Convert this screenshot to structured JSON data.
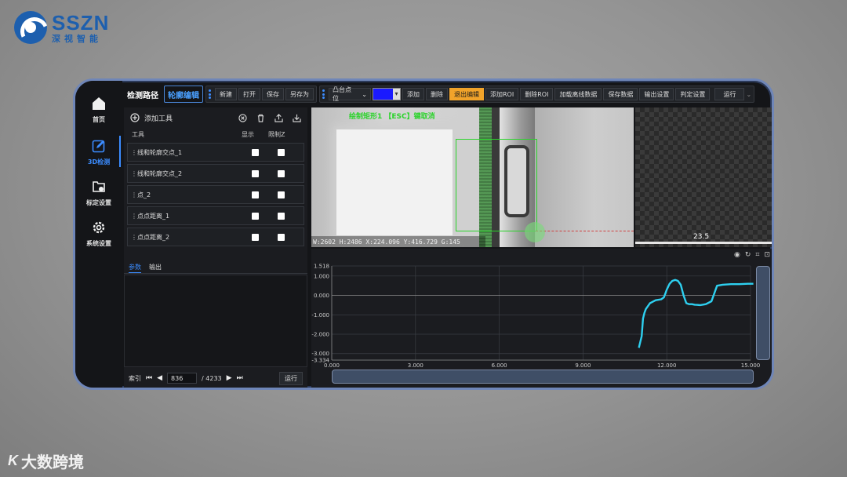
{
  "brand": {
    "name": "SSZN",
    "cn": "深视智能"
  },
  "watermark": {
    "mark": "K",
    "text": "大数跨境"
  },
  "sidebar": {
    "items": [
      {
        "label": "首页",
        "icon": "home-icon"
      },
      {
        "label": "3D检测",
        "icon": "edit-icon",
        "active": true
      },
      {
        "label": "标定设置",
        "icon": "calibration-icon"
      },
      {
        "label": "系统设置",
        "icon": "gear-icon"
      }
    ]
  },
  "toolbar": {
    "path_label": "检测路径",
    "contour_edit": "轮廓编辑",
    "file_buttons": [
      "新建",
      "打开",
      "保存",
      "另存为"
    ],
    "shape_select": "凸台点位",
    "add": "添加",
    "delete": "删除",
    "exit_edit": "退出编辑",
    "add_roi": "添加ROI",
    "delete_roi": "删除ROI",
    "load_offline": "加载离线数据",
    "save_data": "保存数据",
    "output_settings": "输出设置",
    "judge_settings": "判定设置",
    "run": "运行",
    "color_value": "#1a1aff"
  },
  "tools_panel": {
    "add_tool": "添加工具",
    "col_tool": "工具",
    "col_show": "显示",
    "col_limit": "限制Z",
    "rows": [
      {
        "name": "线和轮廓交点_1"
      },
      {
        "name": "线和轮廓交点_2"
      },
      {
        "name": "点_2"
      },
      {
        "name": "点点距离_1"
      },
      {
        "name": "点点距离_2"
      }
    ],
    "tab_params": "参数",
    "tab_output": "输出",
    "index_label": "索引",
    "current_index": "836",
    "total_label": "/ 4233",
    "run": "运行"
  },
  "image_view": {
    "caption": "绘制矩形1 【ESC】键取消",
    "status": "W:2602 H:2486 X:224.096 Y:416.729 G:145"
  },
  "thumb_view": {
    "scale": "23.5"
  },
  "chart_data": {
    "type": "line",
    "title": "",
    "xlabel": "",
    "ylabel": "",
    "xlim": [
      0,
      15
    ],
    "ylim": [
      -3.334,
      1.518
    ],
    "x_ticks": [
      "0.000",
      "3.000",
      "6.000",
      "9.000",
      "12.000",
      "15.000"
    ],
    "y_ticks": [
      "1.518",
      "1.000",
      "0.000",
      "-1.000",
      "-2.000",
      "-3.000",
      "-3.334"
    ],
    "series": [
      {
        "color": "#2ed0f0",
        "x": [
          11.0,
          11.05,
          11.1,
          11.15,
          11.2,
          11.25,
          11.4,
          11.6,
          11.8,
          11.9,
          12.0,
          12.1,
          12.2,
          12.3,
          12.4,
          12.5,
          12.6,
          12.7,
          12.8,
          12.9,
          13.0,
          13.2,
          13.4,
          13.6,
          13.8,
          14.0,
          14.3,
          14.6,
          14.9,
          15.1
        ],
        "y": [
          -2.7,
          -2.4,
          -2.1,
          -1.2,
          -0.9,
          -0.7,
          -0.4,
          -0.25,
          -0.2,
          -0.1,
          0.3,
          0.6,
          0.75,
          0.8,
          0.75,
          0.55,
          0.0,
          -0.4,
          -0.45,
          -0.45,
          -0.48,
          -0.5,
          -0.45,
          -0.3,
          0.5,
          0.55,
          0.58,
          0.58,
          0.6,
          0.6
        ]
      }
    ],
    "grid": true
  }
}
